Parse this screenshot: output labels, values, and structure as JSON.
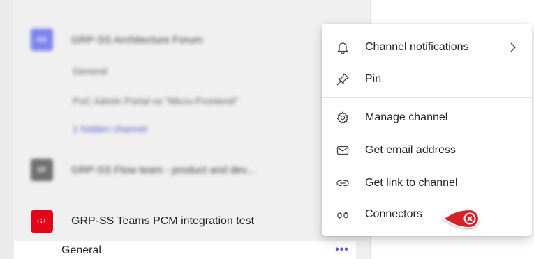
{
  "teams": [
    {
      "avatar_text": "GS",
      "avatar_color": "#7b83eb",
      "name": "GRP-SS Architecture Forum",
      "channels": [
        "General",
        "PoC Admin Portal vs \"Micro-Frontend\""
      ],
      "hidden_channels": "1 hidden channel"
    },
    {
      "avatar_text": "GF",
      "avatar_color": "#6e6e6e",
      "name": "GRP-SS Flow team - product and dev..."
    },
    {
      "avatar_text": "GT",
      "avatar_color": "#e3061b",
      "name": "GRP-SS Teams PCM integration test",
      "selected_channel": "General",
      "more_label": "•••"
    }
  ],
  "context_menu": {
    "items": [
      {
        "label": "Channel notifications",
        "icon": "bell-icon",
        "has_submenu": true
      },
      {
        "label": "Pin",
        "icon": "pin-icon"
      },
      {
        "label": "Manage channel",
        "icon": "gear-icon"
      },
      {
        "label": "Get email address",
        "icon": "mail-icon"
      },
      {
        "label": "Get link to channel",
        "icon": "link-icon"
      },
      {
        "label": "Connectors",
        "icon": "plug-icon"
      }
    ]
  },
  "colors": {
    "accent": "#5b5fc7",
    "callout_marker": "#d3232c"
  }
}
